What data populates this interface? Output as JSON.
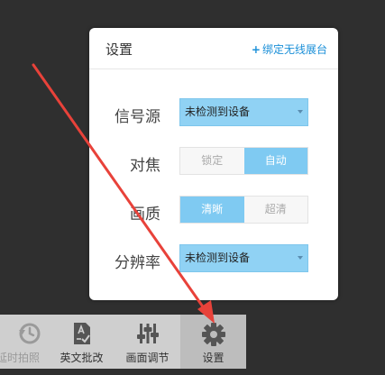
{
  "panel": {
    "title": "设置",
    "bind_link": "绑定无线展台",
    "bind_plus": "+"
  },
  "rows": {
    "source": {
      "label": "信号源",
      "value": "未检测到设备"
    },
    "focus": {
      "label": "对焦",
      "options": [
        "锁定",
        "自动"
      ],
      "selected": "自动"
    },
    "quality": {
      "label": "画质",
      "options": [
        "清晰",
        "超清"
      ],
      "selected": "清晰"
    },
    "resolution": {
      "label": "分辨率",
      "value": "未检测到设备"
    }
  },
  "toolbar": {
    "items": [
      {
        "label": "延时拍照",
        "icon": "history-icon"
      },
      {
        "label": "英文批改",
        "icon": "document-check-icon"
      },
      {
        "label": "画面调节",
        "icon": "sliders-icon"
      },
      {
        "label": "设置",
        "icon": "gear-icon"
      }
    ]
  },
  "colors": {
    "accent": "#7fcaf2",
    "link": "#1a8fd8",
    "annotation_arrow": "#e8423a"
  }
}
